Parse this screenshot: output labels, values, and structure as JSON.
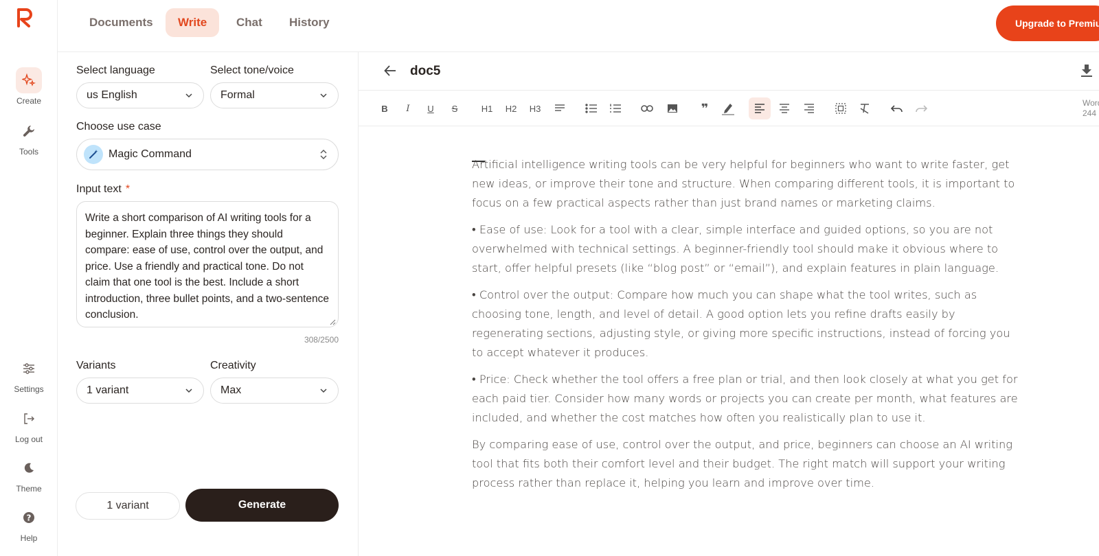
{
  "nav": {
    "tabs": [
      "Documents",
      "Write",
      "Chat",
      "History"
    ],
    "active_tab": "Write",
    "upgrade_label": "Upgrade to Premium"
  },
  "rail": {
    "create": "Create",
    "tools": "Tools",
    "settings": "Settings",
    "logout": "Log out",
    "theme": "Theme",
    "help": "Help"
  },
  "panel": {
    "language_label": "Select language",
    "language_value": "us English",
    "tone_label": "Select tone/voice",
    "tone_value": "Formal",
    "usecase_label": "Choose use case",
    "usecase_value": "Magic Command",
    "input_label": "Input text",
    "required_mark": "*",
    "input_value": "Write a short comparison of AI writing tools for a beginner. Explain three things they should compare: ease of use, control over the output, and price. Use a friendly and practical tone. Do not claim that one tool is the best. Include a short introduction, three bullet points, and a two-sentence conclusion.",
    "counter": "308/2500",
    "variants_label": "Variants",
    "variants_value": "1 variant",
    "creativity_label": "Creativity",
    "creativity_value": "Max",
    "variant_pill": "1 variant",
    "generate_label": "Generate"
  },
  "editor": {
    "doc_title": "doc5",
    "word_count_label": "Words",
    "word_count_value": "244",
    "toolbar": {
      "bold": "B",
      "italic": "I",
      "underline": "U",
      "strike": "S",
      "h1": "H1",
      "h2": "H2",
      "h3": "H3"
    },
    "paragraphs": [
      "Artificial intelligence writing tools can be very helpful for beginners who want to write faster, get new ideas, or improve their tone and structure. When comparing different tools, it is important to focus on a few practical aspects rather than just brand names or marketing claims.",
      "• Ease of use: Look for a tool with a clear, simple interface and guided options, so you are not overwhelmed with technical settings. A beginner-friendly tool should make it obvious where to start, offer helpful presets (like “blog post” or “email”), and explain features in plain language.",
      "• Control over the output: Compare how much you can shape what the tool writes, such as choosing tone, length, and level of detail. A good option lets you refine drafts easily by regenerating sections, adjusting style, or giving more specific instructions, instead of forcing you to accept whatever it produces.",
      "• Price: Check whether the tool offers a free plan or trial, and then look closely at what you get for each paid tier. Consider how many words or projects you can create per month, what features are included, and whether the cost matches how often you realistically plan to use it.",
      "By comparing ease of use, control over the output, and price, beginners can choose an AI writing tool that fits both their comfort level and their budget. The right match will support your writing process rather than replace it, helping you learn and improve over time."
    ]
  },
  "colors": {
    "accent": "#e8431a",
    "accent_soft": "#fbe3da",
    "dark_button": "#2a1f1b"
  }
}
